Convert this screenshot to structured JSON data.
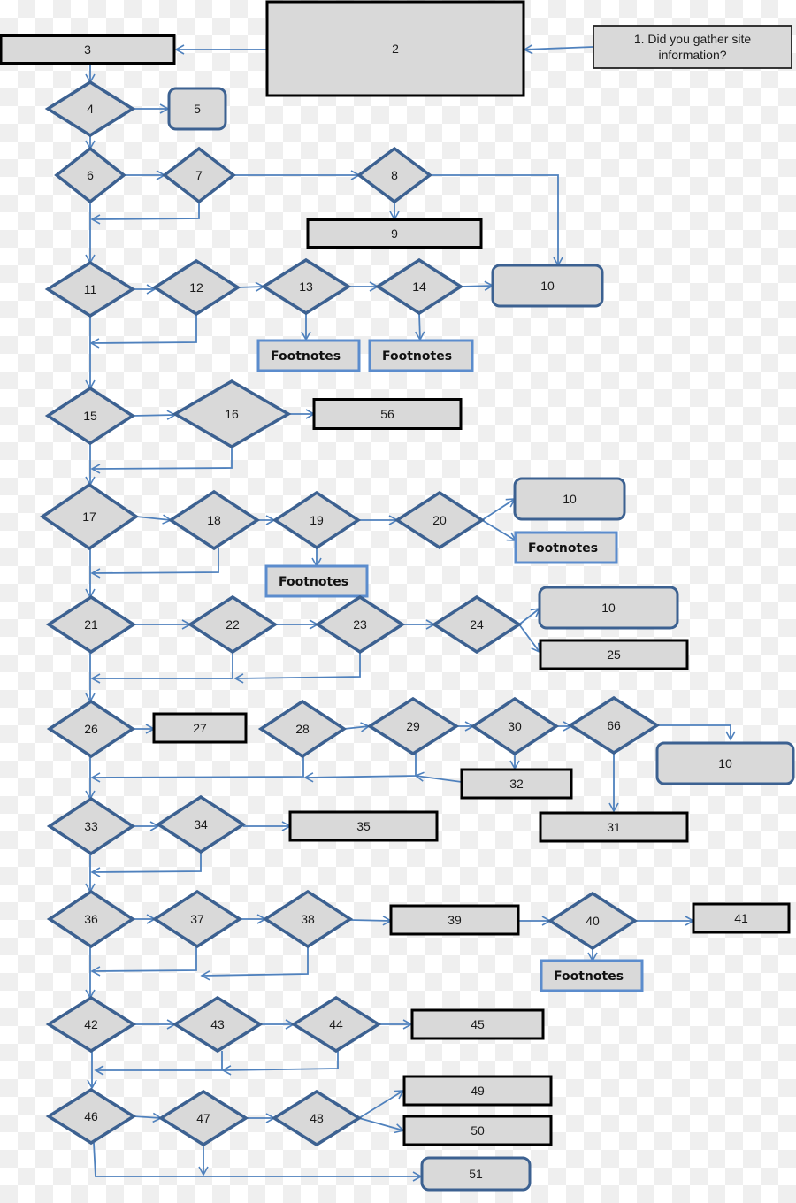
{
  "diagram": {
    "type": "flowchart",
    "colors": {
      "node_fill": "#d9d9d9",
      "decision_stroke": "#3c6191",
      "terminal_stroke": "#3c6191",
      "process_stroke": "#000000",
      "footnote_stroke": "#5b8ccd",
      "edge": "#4f81bd"
    },
    "nodes": [
      {
        "id": "n1",
        "label": "1. Did you gather site information?",
        "lines": [
          "1. Did you gather site",
          "information?"
        ],
        "shape": "process-light"
      },
      {
        "id": "n2",
        "label": "2",
        "shape": "process"
      },
      {
        "id": "n3",
        "label": "3",
        "shape": "process"
      },
      {
        "id": "n4",
        "label": "4",
        "shape": "decision"
      },
      {
        "id": "n5",
        "label": "5",
        "shape": "terminal"
      },
      {
        "id": "n6",
        "label": "6",
        "shape": "decision"
      },
      {
        "id": "n7",
        "label": "7",
        "shape": "decision"
      },
      {
        "id": "n8",
        "label": "8",
        "shape": "decision"
      },
      {
        "id": "n9",
        "label": "9",
        "shape": "process"
      },
      {
        "id": "n10a",
        "label": "10",
        "shape": "terminal"
      },
      {
        "id": "n11",
        "label": "11",
        "shape": "decision"
      },
      {
        "id": "n12",
        "label": "12",
        "shape": "decision"
      },
      {
        "id": "n13",
        "label": "13",
        "shape": "decision"
      },
      {
        "id": "n14",
        "label": "14",
        "shape": "decision"
      },
      {
        "id": "fn13",
        "label": "Footnotes",
        "shape": "footnote"
      },
      {
        "id": "fn14",
        "label": "Footnotes",
        "shape": "footnote"
      },
      {
        "id": "n15",
        "label": "15",
        "shape": "decision"
      },
      {
        "id": "n16",
        "label": "16",
        "shape": "decision"
      },
      {
        "id": "n56",
        "label": "56",
        "shape": "process"
      },
      {
        "id": "n17",
        "label": "17",
        "shape": "decision"
      },
      {
        "id": "n18",
        "label": "18",
        "shape": "decision"
      },
      {
        "id": "n19",
        "label": "19",
        "shape": "decision"
      },
      {
        "id": "n20",
        "label": "20",
        "shape": "decision"
      },
      {
        "id": "n10b",
        "label": "10",
        "shape": "terminal"
      },
      {
        "id": "fn20",
        "label": "Footnotes",
        "shape": "footnote"
      },
      {
        "id": "fn19",
        "label": "Footnotes",
        "shape": "footnote"
      },
      {
        "id": "n21",
        "label": "21",
        "shape": "decision"
      },
      {
        "id": "n22",
        "label": "22",
        "shape": "decision"
      },
      {
        "id": "n23",
        "label": "23",
        "shape": "decision"
      },
      {
        "id": "n24",
        "label": "24",
        "shape": "decision"
      },
      {
        "id": "n10c",
        "label": "10",
        "shape": "terminal"
      },
      {
        "id": "n25",
        "label": "25",
        "shape": "process"
      },
      {
        "id": "n26",
        "label": "26",
        "shape": "decision"
      },
      {
        "id": "n27",
        "label": "27",
        "shape": "process"
      },
      {
        "id": "n28",
        "label": "28",
        "shape": "decision"
      },
      {
        "id": "n29",
        "label": "29",
        "shape": "decision"
      },
      {
        "id": "n30",
        "label": "30",
        "shape": "decision"
      },
      {
        "id": "n66",
        "label": "66",
        "shape": "decision"
      },
      {
        "id": "n10d",
        "label": "10",
        "shape": "terminal"
      },
      {
        "id": "n32",
        "label": "32",
        "shape": "process"
      },
      {
        "id": "n31",
        "label": "31",
        "shape": "process"
      },
      {
        "id": "n33",
        "label": "33",
        "shape": "decision"
      },
      {
        "id": "n34",
        "label": "34",
        "shape": "decision"
      },
      {
        "id": "n35",
        "label": "35",
        "shape": "process"
      },
      {
        "id": "n36",
        "label": "36",
        "shape": "decision"
      },
      {
        "id": "n37",
        "label": "37",
        "shape": "decision"
      },
      {
        "id": "n38",
        "label": "38",
        "shape": "decision"
      },
      {
        "id": "n39",
        "label": "39",
        "shape": "process"
      },
      {
        "id": "n40",
        "label": "40",
        "shape": "decision"
      },
      {
        "id": "n41",
        "label": "41",
        "shape": "process"
      },
      {
        "id": "fn40",
        "label": "Footnotes",
        "shape": "footnote"
      },
      {
        "id": "n42",
        "label": "42",
        "shape": "decision"
      },
      {
        "id": "n43",
        "label": "43",
        "shape": "decision"
      },
      {
        "id": "n44",
        "label": "44",
        "shape": "decision"
      },
      {
        "id": "n45",
        "label": "45",
        "shape": "process"
      },
      {
        "id": "n46",
        "label": "46",
        "shape": "decision"
      },
      {
        "id": "n47",
        "label": "47",
        "shape": "decision"
      },
      {
        "id": "n48",
        "label": "48",
        "shape": "decision"
      },
      {
        "id": "n49",
        "label": "49",
        "shape": "process"
      },
      {
        "id": "n50",
        "label": "50",
        "shape": "process"
      },
      {
        "id": "n51",
        "label": "51",
        "shape": "terminal"
      }
    ],
    "edges": [
      {
        "from": "n1",
        "to": "n2"
      },
      {
        "from": "n2",
        "to": "n3"
      },
      {
        "from": "n3",
        "to": "n4"
      },
      {
        "from": "n4",
        "to": "n5"
      },
      {
        "from": "n4",
        "to": "n6"
      },
      {
        "from": "n6",
        "to": "n7"
      },
      {
        "from": "n7",
        "to": "n8"
      },
      {
        "from": "n7",
        "to": "n11"
      },
      {
        "from": "n8",
        "to": "n9"
      },
      {
        "from": "n8",
        "to": "n10a"
      },
      {
        "from": "n6",
        "to": "n11"
      },
      {
        "from": "n11",
        "to": "n12"
      },
      {
        "from": "n12",
        "to": "n13"
      },
      {
        "from": "n13",
        "to": "n14"
      },
      {
        "from": "n14",
        "to": "n10a"
      },
      {
        "from": "n13",
        "to": "fn13"
      },
      {
        "from": "n14",
        "to": "fn14"
      },
      {
        "from": "n12",
        "to": "n15"
      },
      {
        "from": "n11",
        "to": "n15"
      },
      {
        "from": "n15",
        "to": "n16"
      },
      {
        "from": "n16",
        "to": "n56"
      },
      {
        "from": "n16",
        "to": "n17"
      },
      {
        "from": "n15",
        "to": "n17"
      },
      {
        "from": "n17",
        "to": "n18"
      },
      {
        "from": "n18",
        "to": "n19"
      },
      {
        "from": "n19",
        "to": "n20"
      },
      {
        "from": "n20",
        "to": "n10b"
      },
      {
        "from": "n20",
        "to": "fn20"
      },
      {
        "from": "n19",
        "to": "fn19"
      },
      {
        "from": "n18",
        "to": "n21"
      },
      {
        "from": "n17",
        "to": "n21"
      },
      {
        "from": "n21",
        "to": "n22"
      },
      {
        "from": "n22",
        "to": "n23"
      },
      {
        "from": "n23",
        "to": "n24"
      },
      {
        "from": "n24",
        "to": "n10c"
      },
      {
        "from": "n24",
        "to": "n25"
      },
      {
        "from": "n22",
        "to": "n26"
      },
      {
        "from": "n23",
        "to": "n26"
      },
      {
        "from": "n21",
        "to": "n26"
      },
      {
        "from": "n26",
        "to": "n27"
      },
      {
        "from": "n28",
        "to": "n29"
      },
      {
        "from": "n29",
        "to": "n30"
      },
      {
        "from": "n30",
        "to": "n66"
      },
      {
        "from": "n66",
        "to": "n10d"
      },
      {
        "from": "n66",
        "to": "n31"
      },
      {
        "from": "n30",
        "to": "n32"
      },
      {
        "from": "n32",
        "to": "n33"
      },
      {
        "from": "n29",
        "to": "n33"
      },
      {
        "from": "n28",
        "to": "n33"
      },
      {
        "from": "n26",
        "to": "n33"
      },
      {
        "from": "n33",
        "to": "n34"
      },
      {
        "from": "n34",
        "to": "n35"
      },
      {
        "from": "n34",
        "to": "n36"
      },
      {
        "from": "n33",
        "to": "n36"
      },
      {
        "from": "n36",
        "to": "n37"
      },
      {
        "from": "n37",
        "to": "n38"
      },
      {
        "from": "n38",
        "to": "n39"
      },
      {
        "from": "n39",
        "to": "n40"
      },
      {
        "from": "n40",
        "to": "n41"
      },
      {
        "from": "n40",
        "to": "fn40"
      },
      {
        "from": "n37",
        "to": "n42"
      },
      {
        "from": "n38",
        "to": "n42"
      },
      {
        "from": "n36",
        "to": "n42"
      },
      {
        "from": "n42",
        "to": "n43"
      },
      {
        "from": "n43",
        "to": "n44"
      },
      {
        "from": "n44",
        "to": "n45"
      },
      {
        "from": "n43",
        "to": "n46"
      },
      {
        "from": "n44",
        "to": "n46"
      },
      {
        "from": "n42",
        "to": "n46"
      },
      {
        "from": "n46",
        "to": "n47"
      },
      {
        "from": "n47",
        "to": "n48"
      },
      {
        "from": "n48",
        "to": "n49"
      },
      {
        "from": "n48",
        "to": "n50"
      },
      {
        "from": "n47",
        "to": "n51"
      },
      {
        "from": "n46",
        "to": "n51"
      }
    ]
  }
}
